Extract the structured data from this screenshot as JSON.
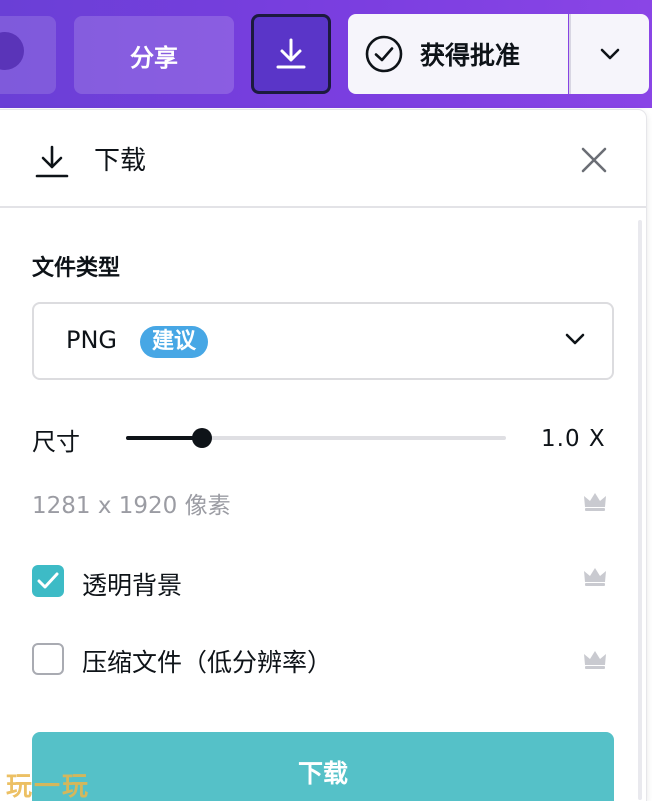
{
  "topbar": {
    "share_label": "分享",
    "approval_label": "获得批准"
  },
  "panel": {
    "title": "下载",
    "file_type_label": "文件类型",
    "file_type_value": "PNG",
    "recommended_badge": "建议",
    "size_label": "尺寸",
    "size_value": "1.0  X",
    "size_slider_fraction": 0.2,
    "pixel_info": "1281 x 1920 像素",
    "transparent_bg_label": "透明背景",
    "transparent_bg_checked": true,
    "compress_label": "压缩文件（低分辨率）",
    "compress_checked": false,
    "download_button": "下载"
  },
  "watermark": "玩一玩",
  "colors": {
    "topbar": "#7b3ee0",
    "badge": "#47a7e5",
    "checkbox": "#3dbbc6",
    "download_button": "#55c1c8"
  }
}
